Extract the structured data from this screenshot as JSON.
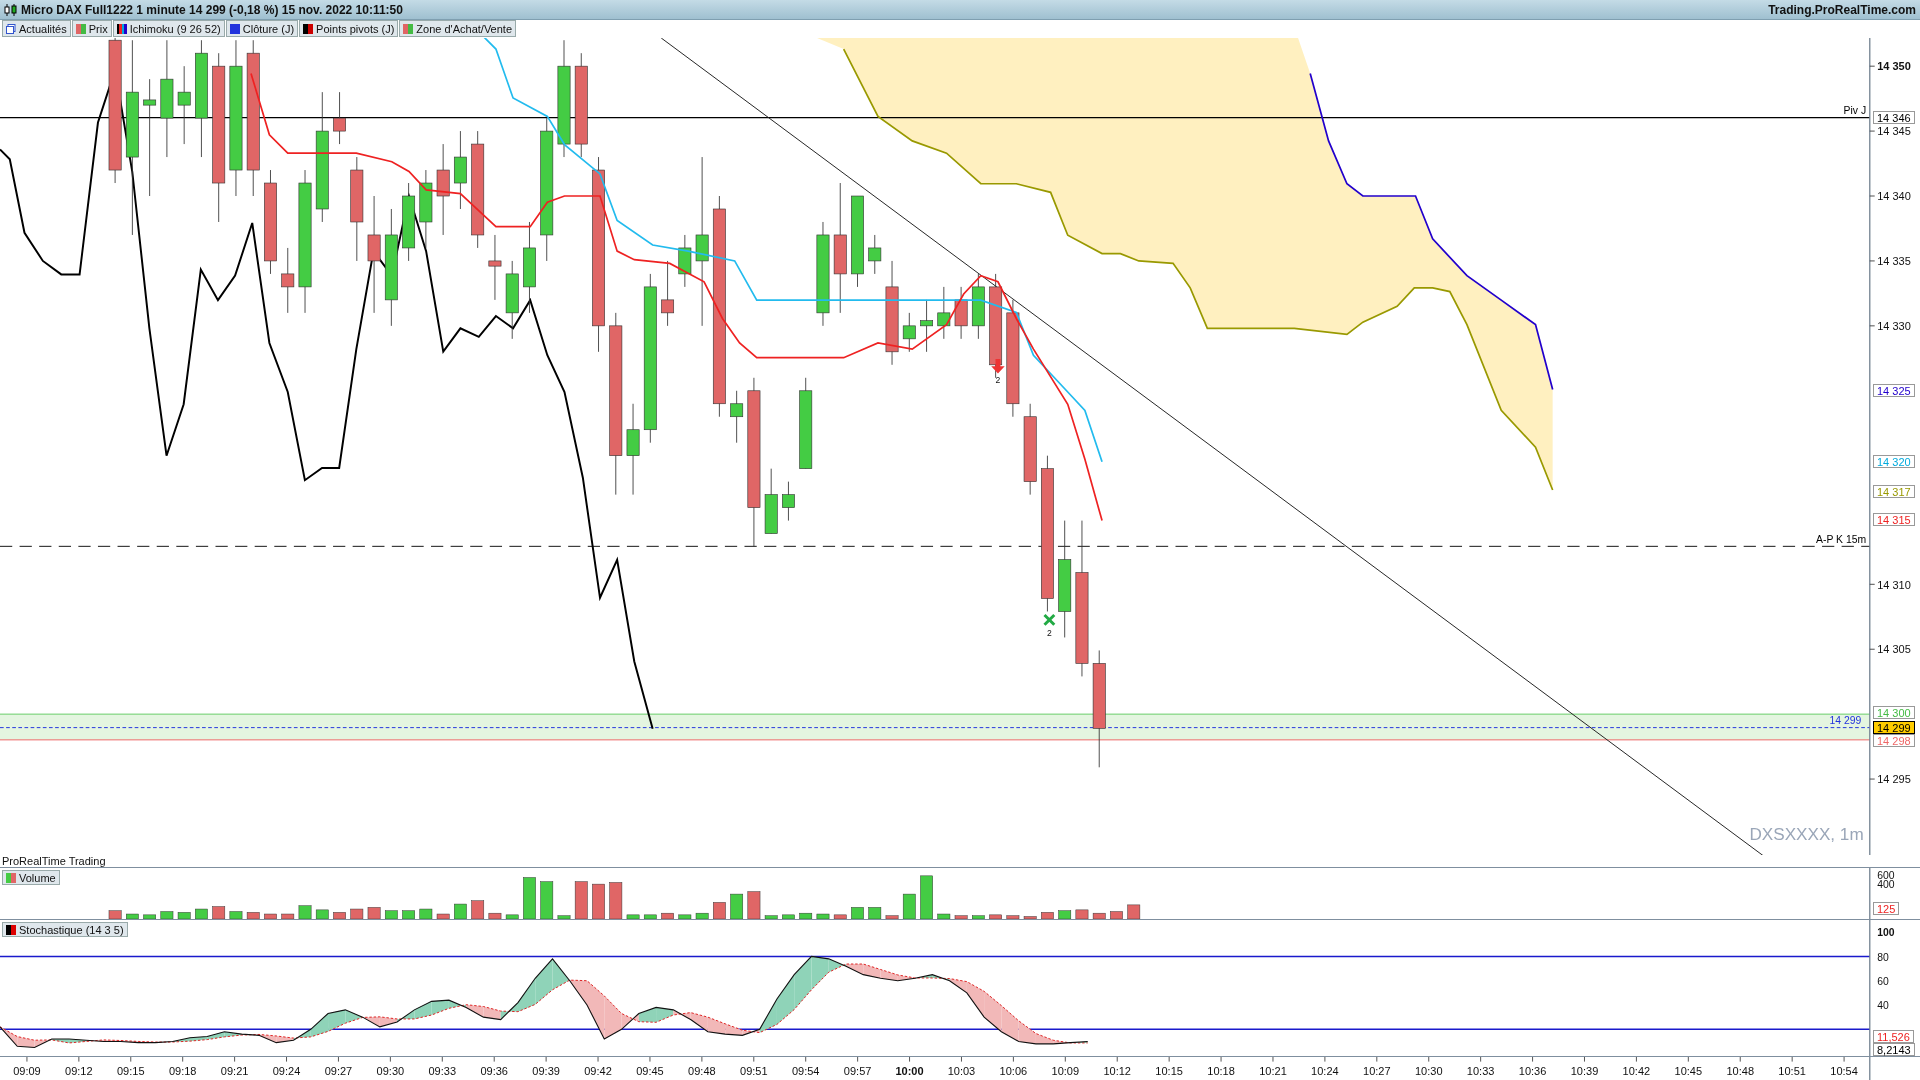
{
  "window": {
    "title": "Micro DAX Full1222 1 minute 14 299 (-0,18 %) 15 nov. 2022 10:11:50",
    "site": "Trading.ProRealTime.com"
  },
  "legend": [
    {
      "label": "Actualités",
      "kind": "news"
    },
    {
      "label": "Prix",
      "kind": "swatch"
    },
    {
      "label": "Ichimoku (9 26 52)",
      "kind": "swatch"
    },
    {
      "label": "Clôture (J)",
      "kind": "swatch"
    },
    {
      "label": "Points pivots (J)",
      "kind": "swatch"
    },
    {
      "label": "Zone d'Achat/Vente",
      "kind": "swatch"
    }
  ],
  "chart": {
    "level_labels": [
      {
        "text": "Piv J"
      },
      {
        "text": "A-P K 15m"
      },
      {
        "text": "14 299"
      }
    ],
    "signals": [
      {
        "label": "2",
        "kind": "sell"
      },
      {
        "label": "2",
        "kind": "buy"
      }
    ],
    "symbol_caption": "DXSXXXX, 1m",
    "price_ticks": [
      "14 350",
      "14 345",
      "14 340",
      "14 335",
      "14 330",
      "14 310",
      "14 305",
      "14 295"
    ],
    "price_tags": [
      {
        "text": "14 346",
        "color": "#000000",
        "highlighted": false
      },
      {
        "text": "14 325",
        "color": "#2200cc",
        "highlighted": false
      },
      {
        "text": "14 320",
        "color": "#00aadd",
        "highlighted": false
      },
      {
        "text": "14 317",
        "color": "#999900",
        "highlighted": false
      },
      {
        "text": "14 315",
        "color": "#ee2222",
        "highlighted": false
      },
      {
        "text": "14 300",
        "color": "#44bb44",
        "highlighted": false
      },
      {
        "text": "14 299",
        "color": "#000000",
        "highlighted": true
      },
      {
        "text": "14 298",
        "color": "#ee6666",
        "highlighted": false
      }
    ],
    "footer": "ProRealTime Trading"
  },
  "volume": {
    "label": "Volume",
    "ticks": [
      "600",
      "400"
    ],
    "tag": {
      "text": "125",
      "color": "#ee2222"
    }
  },
  "stochastic": {
    "label": "Stochastique (14 3 5)",
    "ticks": [
      "100",
      "80",
      "60",
      "40"
    ],
    "tags": [
      {
        "text": "11,526",
        "color": "#ee2222"
      },
      {
        "text": "8,2143",
        "color": "#000000"
      }
    ]
  },
  "time_axis": [
    {
      "label": "09:09",
      "major": false
    },
    {
      "label": "09:12",
      "major": false
    },
    {
      "label": "09:15",
      "major": false
    },
    {
      "label": "09:18",
      "major": false
    },
    {
      "label": "09:21",
      "major": false
    },
    {
      "label": "09:24",
      "major": false
    },
    {
      "label": "09:27",
      "major": false
    },
    {
      "label": "09:30",
      "major": false
    },
    {
      "label": "09:33",
      "major": false
    },
    {
      "label": "09:36",
      "major": false
    },
    {
      "label": "09:39",
      "major": false
    },
    {
      "label": "09:42",
      "major": false
    },
    {
      "label": "09:45",
      "major": false
    },
    {
      "label": "09:48",
      "major": false
    },
    {
      "label": "09:51",
      "major": false
    },
    {
      "label": "09:54",
      "major": false
    },
    {
      "label": "09:57",
      "major": false
    },
    {
      "label": "10:00",
      "major": true
    },
    {
      "label": "10:03",
      "major": false
    },
    {
      "label": "10:06",
      "major": false
    },
    {
      "label": "10:09",
      "major": false
    },
    {
      "label": "10:12",
      "major": false
    },
    {
      "label": "10:15",
      "major": false
    },
    {
      "label": "10:18",
      "major": false
    },
    {
      "label": "10:21",
      "major": false
    },
    {
      "label": "10:24",
      "major": false
    },
    {
      "label": "10:27",
      "major": false
    },
    {
      "label": "10:30",
      "major": false
    },
    {
      "label": "10:33",
      "major": false
    },
    {
      "label": "10:36",
      "major": false
    },
    {
      "label": "10:39",
      "major": false
    },
    {
      "label": "10:42",
      "major": false
    },
    {
      "label": "10:45",
      "major": false
    },
    {
      "label": "10:48",
      "major": false
    },
    {
      "label": "10:51",
      "major": false
    },
    {
      "label": "10:54",
      "major": false
    }
  ]
}
